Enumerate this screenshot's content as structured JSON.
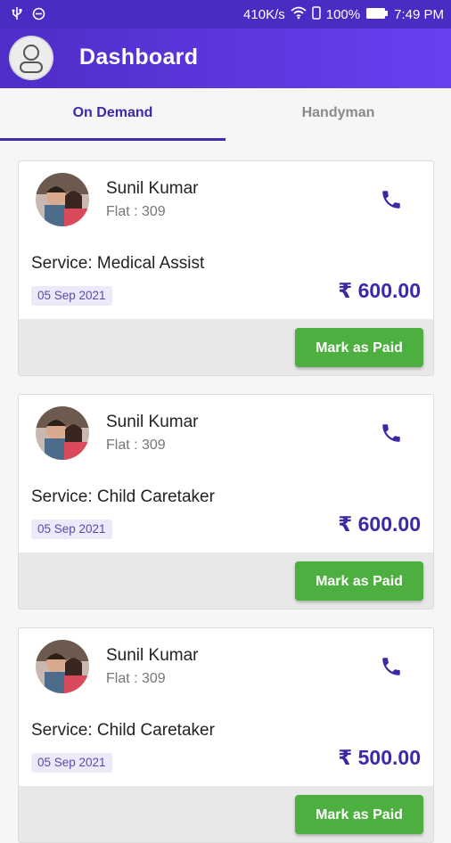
{
  "status_bar": {
    "speed": "410K/s",
    "battery": "100%",
    "time": "7:49 PM"
  },
  "app_bar": {
    "title": "Dashboard"
  },
  "tabs": [
    {
      "label": "On Demand"
    },
    {
      "label": "Handyman"
    }
  ],
  "bookings": [
    {
      "name": "Sunil Kumar",
      "flat": "Flat : 309",
      "service": "Service: Medical Assist",
      "date": "05 Sep 2021",
      "amount": "₹ 600.00",
      "action": "Mark as Paid"
    },
    {
      "name": "Sunil Kumar",
      "flat": "Flat : 309",
      "service": "Service: Child Caretaker",
      "date": "05 Sep 2021",
      "amount": "₹ 600.00",
      "action": "Mark as Paid"
    },
    {
      "name": "Sunil Kumar",
      "flat": "Flat : 309",
      "service": "Service: Child Caretaker",
      "date": "05 Sep 2021",
      "amount": "₹ 500.00",
      "action": "Mark as Paid"
    }
  ],
  "colors": {
    "primary": "#4f2dc8",
    "accent_green": "#4caf3f",
    "amount": "#3a2aa5"
  },
  "icons": [
    "usb-icon",
    "no-sim-icon",
    "wifi-icon",
    "battery-icon",
    "profile-icon",
    "phone-icon"
  ]
}
